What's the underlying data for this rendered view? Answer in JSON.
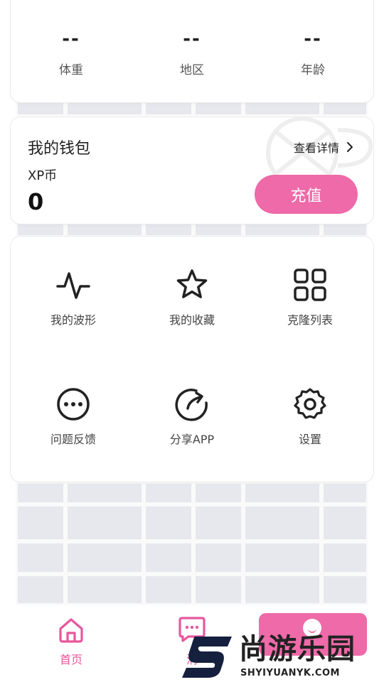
{
  "stats": {
    "items": [
      {
        "value": "--",
        "label": "体重"
      },
      {
        "value": "--",
        "label": "地区"
      },
      {
        "value": "--",
        "label": "年龄"
      }
    ]
  },
  "wallet": {
    "title": "我的钱包",
    "detail_link": "查看详情",
    "coin_label": "XP币",
    "coin_value": "0",
    "recharge_label": "充值"
  },
  "menu": {
    "items": [
      {
        "label": "我的波形",
        "icon": "waveform-icon"
      },
      {
        "label": "我的收藏",
        "icon": "star-icon"
      },
      {
        "label": "克隆列表",
        "icon": "grid-icon"
      },
      {
        "label": "问题反馈",
        "icon": "more-dots-icon"
      },
      {
        "label": "分享APP",
        "icon": "share-icon"
      },
      {
        "label": "设置",
        "icon": "gear-icon"
      }
    ]
  },
  "tabbar": {
    "home_label": "首页",
    "msg_label_partial": "消"
  },
  "watermark": {
    "name": "尚游乐园",
    "url": "SHYIYUANYK.COM"
  },
  "colors": {
    "accent": "#ee6aa8",
    "tab_active": "#e8579c",
    "icon": "#222222"
  }
}
